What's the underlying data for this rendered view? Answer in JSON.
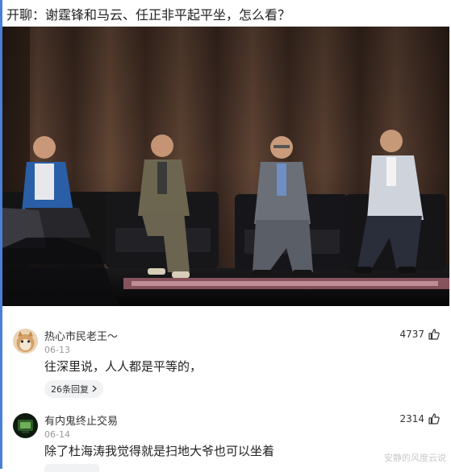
{
  "post": {
    "title": "开聊：谢霆锋和马云、任正非平起平坐，怎么看？"
  },
  "comments": [
    {
      "user": "热心市民老王～",
      "date": "06-13",
      "likes": "4737",
      "text": "往深里说，人人都是平等的，",
      "replies": "26条回复"
    },
    {
      "user": "有内鬼终止交易",
      "date": "06-14",
      "likes": "2314",
      "text": "除了杜海涛我觉得就是扫地大爷也可以坐着"
    }
  ],
  "watermark": "安静的风度云说",
  "colors": {
    "accent": "#4a7fd6",
    "stage_backdrop": "#4a3428"
  },
  "icons": {
    "like": "thumb-up-icon",
    "reply_arrow": "chevron-right-icon"
  }
}
